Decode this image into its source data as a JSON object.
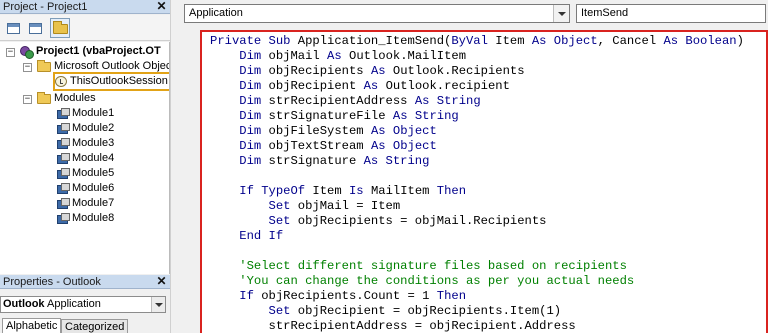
{
  "project_pane": {
    "title": "Project - Project1",
    "close_glyph": "✕",
    "toolbar": [
      "view-code-icon",
      "view-object-icon",
      "toggle-folders-icon"
    ],
    "tree": {
      "root": "Project1 (vbaProject.OT",
      "objects_folder": "Microsoft Outlook Object",
      "session": "ThisOutlookSession",
      "modules_folder": "Modules",
      "modules": [
        "Module1",
        "Module2",
        "Module3",
        "Module4",
        "Module5",
        "Module6",
        "Module7",
        "Module8"
      ]
    }
  },
  "properties_pane": {
    "title": "Properties - Outlook",
    "close_glyph": "✕",
    "object_bold": "Outlook",
    "object_type": "Application",
    "tabs": [
      "Alphabetic",
      "Categorized"
    ]
  },
  "code_window": {
    "object_combo": "Application",
    "procedure_combo": "ItemSend",
    "lines": [
      {
        "indent": 0,
        "parts": [
          [
            "kw",
            "Private Sub "
          ],
          [
            "",
            "Application_ItemSend("
          ],
          [
            "kw",
            "ByVal "
          ],
          [
            "",
            "Item "
          ],
          [
            "kw",
            "As Object"
          ],
          [
            "",
            ", Cancel "
          ],
          [
            "kw",
            "As Boolean"
          ],
          [
            "",
            ")"
          ]
        ]
      },
      {
        "indent": 1,
        "parts": [
          [
            "kw",
            "Dim "
          ],
          [
            "",
            "objMail "
          ],
          [
            "kw",
            "As "
          ],
          [
            "",
            "Outlook.MailItem"
          ]
        ]
      },
      {
        "indent": 1,
        "parts": [
          [
            "kw",
            "Dim "
          ],
          [
            "",
            "objRecipients "
          ],
          [
            "kw",
            "As "
          ],
          [
            "",
            "Outlook.Recipients"
          ]
        ]
      },
      {
        "indent": 1,
        "parts": [
          [
            "kw",
            "Dim "
          ],
          [
            "",
            "objRecipient "
          ],
          [
            "kw",
            "As "
          ],
          [
            "",
            "Outlook.recipient"
          ]
        ]
      },
      {
        "indent": 1,
        "parts": [
          [
            "kw",
            "Dim "
          ],
          [
            "",
            "strRecipientAddress "
          ],
          [
            "kw",
            "As String"
          ]
        ]
      },
      {
        "indent": 1,
        "parts": [
          [
            "kw",
            "Dim "
          ],
          [
            "",
            "strSignatureFile "
          ],
          [
            "kw",
            "As String"
          ]
        ]
      },
      {
        "indent": 1,
        "parts": [
          [
            "kw",
            "Dim "
          ],
          [
            "",
            "objFileSystem "
          ],
          [
            "kw",
            "As Object"
          ]
        ]
      },
      {
        "indent": 1,
        "parts": [
          [
            "kw",
            "Dim "
          ],
          [
            "",
            "objTextStream "
          ],
          [
            "kw",
            "As Object"
          ]
        ]
      },
      {
        "indent": 1,
        "parts": [
          [
            "kw",
            "Dim "
          ],
          [
            "",
            "strSignature "
          ],
          [
            "kw",
            "As String"
          ]
        ]
      },
      {
        "indent": 0,
        "parts": []
      },
      {
        "indent": 1,
        "parts": [
          [
            "kw",
            "If TypeOf "
          ],
          [
            "",
            "Item "
          ],
          [
            "kw",
            "Is "
          ],
          [
            "",
            "MailItem "
          ],
          [
            "kw",
            "Then"
          ]
        ]
      },
      {
        "indent": 2,
        "parts": [
          [
            "kw",
            "Set "
          ],
          [
            "",
            "objMail = Item"
          ]
        ]
      },
      {
        "indent": 2,
        "parts": [
          [
            "kw",
            "Set "
          ],
          [
            "",
            "objRecipients = objMail.Recipients"
          ]
        ]
      },
      {
        "indent": 1,
        "parts": [
          [
            "kw",
            "End If"
          ]
        ]
      },
      {
        "indent": 0,
        "parts": []
      },
      {
        "indent": 1,
        "parts": [
          [
            "cm",
            "'Select different signature files based on recipients"
          ]
        ]
      },
      {
        "indent": 1,
        "parts": [
          [
            "cm",
            "'You can change the conditions as per you actual needs"
          ]
        ]
      },
      {
        "indent": 1,
        "parts": [
          [
            "kw",
            "If "
          ],
          [
            "",
            "objRecipients.Count = 1 "
          ],
          [
            "kw",
            "Then"
          ]
        ]
      },
      {
        "indent": 2,
        "parts": [
          [
            "kw",
            "Set "
          ],
          [
            "",
            "objRecipient = objRecipients.Item(1)"
          ]
        ]
      },
      {
        "indent": 2,
        "parts": [
          [
            "",
            "strRecipientAddress = objRecipient.Address"
          ]
        ]
      }
    ]
  },
  "colors": {
    "highlight_box": "#e2a317",
    "editor_border": "#d9231f",
    "keyword": "#00008b",
    "comment": "#008000"
  }
}
